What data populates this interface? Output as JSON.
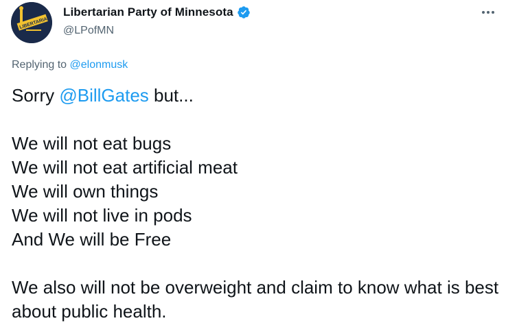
{
  "author": {
    "display_name": "Libertarian Party of Minnesota",
    "handle": "@LPofMN",
    "verified": true,
    "avatar_icon": "libertarian-logo",
    "avatar_text": "LIBERTARIAN"
  },
  "reply_context": {
    "prefix": "Replying to ",
    "mention": "@elonmusk"
  },
  "tweet": {
    "line1_prefix": "Sorry ",
    "line1_mention": "@BillGates",
    "line1_suffix": " but...",
    "list": [
      "We will not eat bugs",
      "We will not eat artificial meat",
      "We will own things",
      "We will not live in pods",
      "And We will be Free"
    ],
    "closing": "We also will not be overweight and claim to know what is best about public health."
  },
  "colors": {
    "link": "#1d9bf0",
    "secondary_text": "#536471",
    "primary_text": "#0f1419",
    "avatar_bg": "#1a2a4a",
    "avatar_accent": "#f2c230"
  },
  "icons": {
    "more": "more-options-icon",
    "verified": "verified-badge-icon"
  }
}
